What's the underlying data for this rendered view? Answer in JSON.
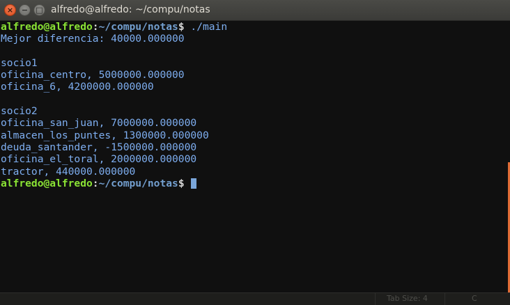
{
  "window": {
    "title": "alfredo@alfredo: ~/compu/notas",
    "buttons": {
      "close_glyph": "×",
      "minimize_glyph": "−",
      "maximize_glyph": "□"
    }
  },
  "terminal": {
    "prompt": {
      "user_host": "alfredo@alfredo",
      "separator": ":",
      "path": "~/compu/notas",
      "symbol": "$ "
    },
    "command": "./main",
    "output": [
      "Mejor diferencia: 40000.000000",
      "",
      "socio1",
      "oficina_centro, 5000000.000000",
      "oficina_6, 4200000.000000",
      "",
      "socio2",
      "oficina_san_juan, 7000000.000000",
      "almacen_los_puntes, 1300000.000000",
      "deuda_santander, -1500000.000000",
      "oficina_el_toral, 2000000.000000",
      "tractor, 440000.000000"
    ]
  },
  "statusbar": {
    "tab_size": "Tab Size: 4",
    "language": "C"
  },
  "colors": {
    "prompt_user": "#8ae234",
    "prompt_path": "#739fcf",
    "output_text": "#7eaef0",
    "background": "#101010",
    "close_button": "#dc4f1f"
  }
}
